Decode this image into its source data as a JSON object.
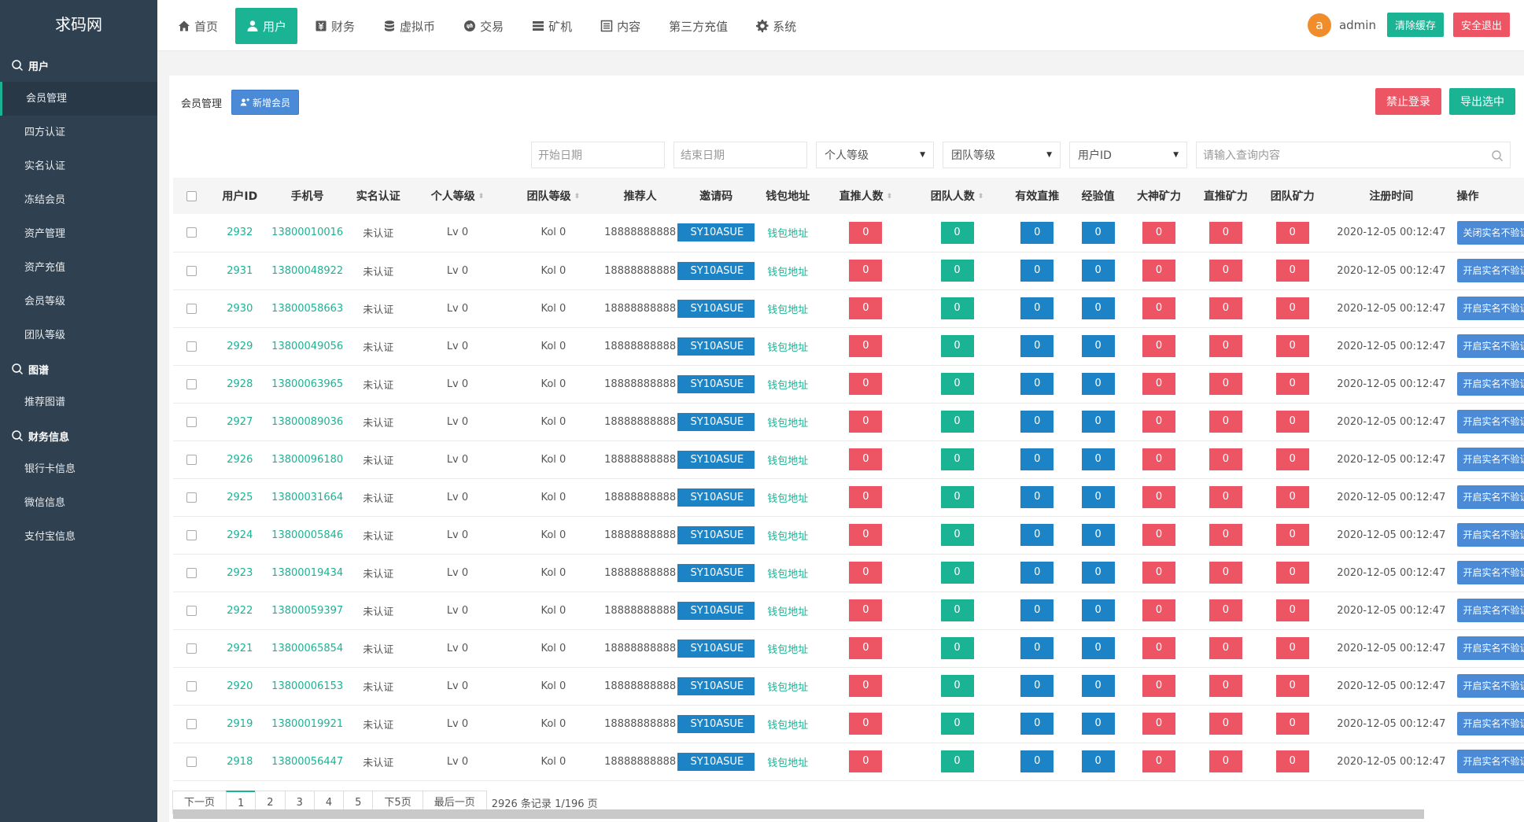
{
  "brand": "求码网",
  "sidebar": {
    "sections": [
      {
        "title": "用户",
        "items": [
          "会员管理",
          "四方认证",
          "实名认证",
          "冻结会员",
          "资产管理",
          "资产充值",
          "会员等级",
          "团队等级"
        ]
      },
      {
        "title": "图谱",
        "items": [
          "推荐图谱"
        ]
      },
      {
        "title": "财务信息",
        "items": [
          "银行卡信息",
          "微信信息",
          "支付宝信息"
        ]
      }
    ],
    "active_item": "会员管理"
  },
  "topbar": {
    "tabs": [
      {
        "label": "首页",
        "icon": "home-icon"
      },
      {
        "label": "用户",
        "icon": "user-icon"
      },
      {
        "label": "财务",
        "icon": "money-icon"
      },
      {
        "label": "虚拟币",
        "icon": "database-icon"
      },
      {
        "label": "交易",
        "icon": "exchange-icon"
      },
      {
        "label": "矿机",
        "icon": "server-icon"
      },
      {
        "label": "内容",
        "icon": "list-icon"
      },
      {
        "label": "第三方充值",
        "icon": ""
      },
      {
        "label": "系统",
        "icon": "gear-icon"
      }
    ],
    "active_tab": "用户",
    "avatar_letter": "a",
    "admin_name": "admin",
    "clear_cache": "清除缓存",
    "logout": "安全退出"
  },
  "panel": {
    "title": "会员管理",
    "add_button": "新增会员",
    "ban_button": "禁止登录",
    "export_button": "导出选中"
  },
  "filters": {
    "start_date": "开始日期",
    "end_date": "结束日期",
    "personal_level": "个人等级",
    "team_level": "团队等级",
    "user_id": "用户ID",
    "search": "请输入查询内容"
  },
  "table": {
    "headers": [
      "用户ID",
      "手机号",
      "实名认证",
      "个人等级",
      "团队等级",
      "推荐人",
      "邀请码",
      "钱包地址",
      "直推人数",
      "团队人数",
      "有效直推",
      "经验值",
      "大神矿力",
      "直推矿力",
      "团队矿力",
      "注册时间",
      "操作"
    ],
    "rows": [
      {
        "id": "2932",
        "phone": "13800010016",
        "realname": "未认证",
        "plevel": "Lv 0",
        "tlevel": "Kol 0",
        "referrer": "18888888888",
        "code": "SY10ASUE",
        "wallet": "钱包地址",
        "n1": "0",
        "n2": "0",
        "n3": "0",
        "n4": "0",
        "n5": "0",
        "n6": "0",
        "n7": "0",
        "time": "2020-12-05 00:12:47",
        "op": "关闭实名不验证"
      },
      {
        "id": "2931",
        "phone": "13800048922",
        "realname": "未认证",
        "plevel": "Lv 0",
        "tlevel": "Kol 0",
        "referrer": "18888888888",
        "code": "SY10ASUE",
        "wallet": "钱包地址",
        "n1": "0",
        "n2": "0",
        "n3": "0",
        "n4": "0",
        "n5": "0",
        "n6": "0",
        "n7": "0",
        "time": "2020-12-05 00:12:47",
        "op": "开启实名不验证"
      },
      {
        "id": "2930",
        "phone": "13800058663",
        "realname": "未认证",
        "plevel": "Lv 0",
        "tlevel": "Kol 0",
        "referrer": "18888888888",
        "code": "SY10ASUE",
        "wallet": "钱包地址",
        "n1": "0",
        "n2": "0",
        "n3": "0",
        "n4": "0",
        "n5": "0",
        "n6": "0",
        "n7": "0",
        "time": "2020-12-05 00:12:47",
        "op": "开启实名不验证"
      },
      {
        "id": "2929",
        "phone": "13800049056",
        "realname": "未认证",
        "plevel": "Lv 0",
        "tlevel": "Kol 0",
        "referrer": "18888888888",
        "code": "SY10ASUE",
        "wallet": "钱包地址",
        "n1": "0",
        "n2": "0",
        "n3": "0",
        "n4": "0",
        "n5": "0",
        "n6": "0",
        "n7": "0",
        "time": "2020-12-05 00:12:47",
        "op": "开启实名不验证"
      },
      {
        "id": "2928",
        "phone": "13800063965",
        "realname": "未认证",
        "plevel": "Lv 0",
        "tlevel": "Kol 0",
        "referrer": "18888888888",
        "code": "SY10ASUE",
        "wallet": "钱包地址",
        "n1": "0",
        "n2": "0",
        "n3": "0",
        "n4": "0",
        "n5": "0",
        "n6": "0",
        "n7": "0",
        "time": "2020-12-05 00:12:47",
        "op": "开启实名不验证"
      },
      {
        "id": "2927",
        "phone": "13800089036",
        "realname": "未认证",
        "plevel": "Lv 0",
        "tlevel": "Kol 0",
        "referrer": "18888888888",
        "code": "SY10ASUE",
        "wallet": "钱包地址",
        "n1": "0",
        "n2": "0",
        "n3": "0",
        "n4": "0",
        "n5": "0",
        "n6": "0",
        "n7": "0",
        "time": "2020-12-05 00:12:47",
        "op": "开启实名不验证"
      },
      {
        "id": "2926",
        "phone": "13800096180",
        "realname": "未认证",
        "plevel": "Lv 0",
        "tlevel": "Kol 0",
        "referrer": "18888888888",
        "code": "SY10ASUE",
        "wallet": "钱包地址",
        "n1": "0",
        "n2": "0",
        "n3": "0",
        "n4": "0",
        "n5": "0",
        "n6": "0",
        "n7": "0",
        "time": "2020-12-05 00:12:47",
        "op": "开启实名不验证"
      },
      {
        "id": "2925",
        "phone": "13800031664",
        "realname": "未认证",
        "plevel": "Lv 0",
        "tlevel": "Kol 0",
        "referrer": "18888888888",
        "code": "SY10ASUE",
        "wallet": "钱包地址",
        "n1": "0",
        "n2": "0",
        "n3": "0",
        "n4": "0",
        "n5": "0",
        "n6": "0",
        "n7": "0",
        "time": "2020-12-05 00:12:47",
        "op": "开启实名不验证"
      },
      {
        "id": "2924",
        "phone": "13800005846",
        "realname": "未认证",
        "plevel": "Lv 0",
        "tlevel": "Kol 0",
        "referrer": "18888888888",
        "code": "SY10ASUE",
        "wallet": "钱包地址",
        "n1": "0",
        "n2": "0",
        "n3": "0",
        "n4": "0",
        "n5": "0",
        "n6": "0",
        "n7": "0",
        "time": "2020-12-05 00:12:47",
        "op": "开启实名不验证"
      },
      {
        "id": "2923",
        "phone": "13800019434",
        "realname": "未认证",
        "plevel": "Lv 0",
        "tlevel": "Kol 0",
        "referrer": "18888888888",
        "code": "SY10ASUE",
        "wallet": "钱包地址",
        "n1": "0",
        "n2": "0",
        "n3": "0",
        "n4": "0",
        "n5": "0",
        "n6": "0",
        "n7": "0",
        "time": "2020-12-05 00:12:47",
        "op": "开启实名不验证"
      },
      {
        "id": "2922",
        "phone": "13800059397",
        "realname": "未认证",
        "plevel": "Lv 0",
        "tlevel": "Kol 0",
        "referrer": "18888888888",
        "code": "SY10ASUE",
        "wallet": "钱包地址",
        "n1": "0",
        "n2": "0",
        "n3": "0",
        "n4": "0",
        "n5": "0",
        "n6": "0",
        "n7": "0",
        "time": "2020-12-05 00:12:47",
        "op": "开启实名不验证"
      },
      {
        "id": "2921",
        "phone": "13800065854",
        "realname": "未认证",
        "plevel": "Lv 0",
        "tlevel": "Kol 0",
        "referrer": "18888888888",
        "code": "SY10ASUE",
        "wallet": "钱包地址",
        "n1": "0",
        "n2": "0",
        "n3": "0",
        "n4": "0",
        "n5": "0",
        "n6": "0",
        "n7": "0",
        "time": "2020-12-05 00:12:47",
        "op": "开启实名不验证"
      },
      {
        "id": "2920",
        "phone": "13800006153",
        "realname": "未认证",
        "plevel": "Lv 0",
        "tlevel": "Kol 0",
        "referrer": "18888888888",
        "code": "SY10ASUE",
        "wallet": "钱包地址",
        "n1": "0",
        "n2": "0",
        "n3": "0",
        "n4": "0",
        "n5": "0",
        "n6": "0",
        "n7": "0",
        "time": "2020-12-05 00:12:47",
        "op": "开启实名不验证"
      },
      {
        "id": "2919",
        "phone": "13800019921",
        "realname": "未认证",
        "plevel": "Lv 0",
        "tlevel": "Kol 0",
        "referrer": "18888888888",
        "code": "SY10ASUE",
        "wallet": "钱包地址",
        "n1": "0",
        "n2": "0",
        "n3": "0",
        "n4": "0",
        "n5": "0",
        "n6": "0",
        "n7": "0",
        "time": "2020-12-05 00:12:47",
        "op": "开启实名不验证"
      },
      {
        "id": "2918",
        "phone": "13800056447",
        "realname": "未认证",
        "plevel": "Lv 0",
        "tlevel": "Kol 0",
        "referrer": "18888888888",
        "code": "SY10ASUE",
        "wallet": "钱包地址",
        "n1": "0",
        "n2": "0",
        "n3": "0",
        "n4": "0",
        "n5": "0",
        "n6": "0",
        "n7": "0",
        "time": "2020-12-05 00:12:47",
        "op": "开启实名不验证"
      }
    ]
  },
  "pagination": {
    "prev": "下一页",
    "pages": [
      "1",
      "2",
      "3",
      "4",
      "5"
    ],
    "active_page": "1",
    "next5": "下5页",
    "last": "最后一页",
    "info": "2926 条记录 1/196 页"
  },
  "colors": {
    "sidebar_bg": "#2f4050",
    "primary_green": "#1ab394",
    "danger_red": "#ed5565",
    "info_blue": "#1c84c6"
  }
}
